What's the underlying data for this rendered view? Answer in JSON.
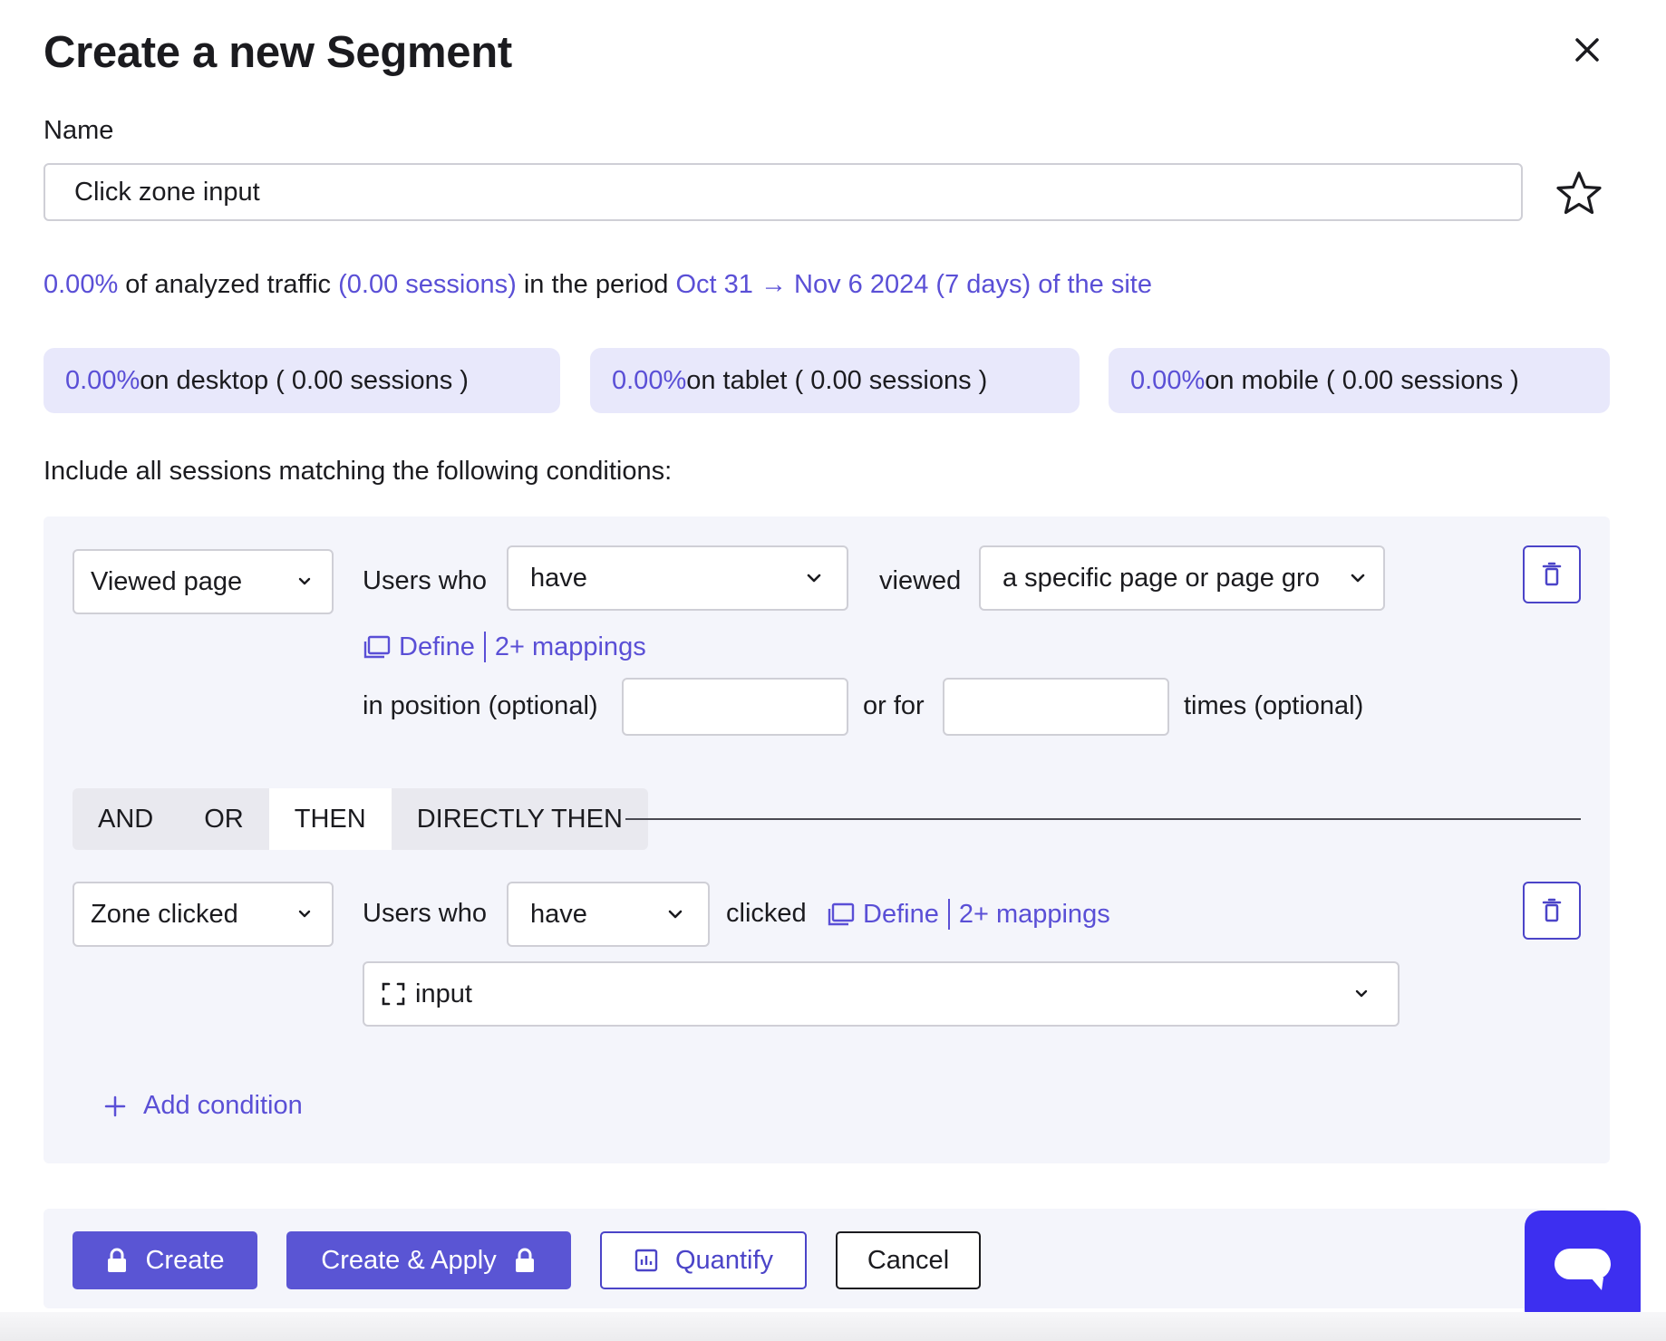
{
  "dialog": {
    "title": "Create a new Segment",
    "close_icon": "close-icon"
  },
  "name": {
    "label": "Name",
    "value": "Click zone input",
    "favorite_icon": "star-outline-icon"
  },
  "traffic": {
    "percent": "0.00%",
    "text1": " of analyzed traffic ",
    "sessions": "(0.00 sessions)",
    "text2": " in the period ",
    "period": "Oct 31 → Nov 6 2024 (7 days) of the site"
  },
  "devices": [
    {
      "percent": "0.00%",
      "text": " on desktop ( 0.00 sessions )"
    },
    {
      "percent": "0.00%",
      "text": " on tablet ( 0.00 sessions )"
    },
    {
      "percent": "0.00%",
      "text": " on mobile ( 0.00 sessions )"
    }
  ],
  "conditions_intro": "Include all sessions matching the following conditions:",
  "condition1": {
    "type": "Viewed page",
    "users_who": "Users who",
    "have": "have",
    "verb": "viewed",
    "target": "a specific page or page gro",
    "define": "Define",
    "mappings": "2+ mappings",
    "position_label": "in position (optional)",
    "position_value": "",
    "or_for": "or for",
    "times_value": "",
    "times_label": "times (optional)"
  },
  "operators": {
    "items": [
      "AND",
      "OR",
      "THEN",
      "DIRECTLY THEN"
    ],
    "selected": "THEN"
  },
  "condition2": {
    "type": "Zone clicked",
    "users_who": "Users who",
    "have": "have",
    "verb": "clicked",
    "define": "Define",
    "mappings": "2+ mappings",
    "zone": "input"
  },
  "add_condition": "Add condition",
  "footer": {
    "create": "Create",
    "create_apply": "Create & Apply",
    "quantify": "Quantify",
    "cancel": "Cancel"
  },
  "colors": {
    "accent": "#5a4fd6",
    "primary_button": "#5a55d4",
    "chat_button": "#3d2ff0",
    "device_card": "#e8e8fb",
    "panel": "#f4f5fb"
  }
}
